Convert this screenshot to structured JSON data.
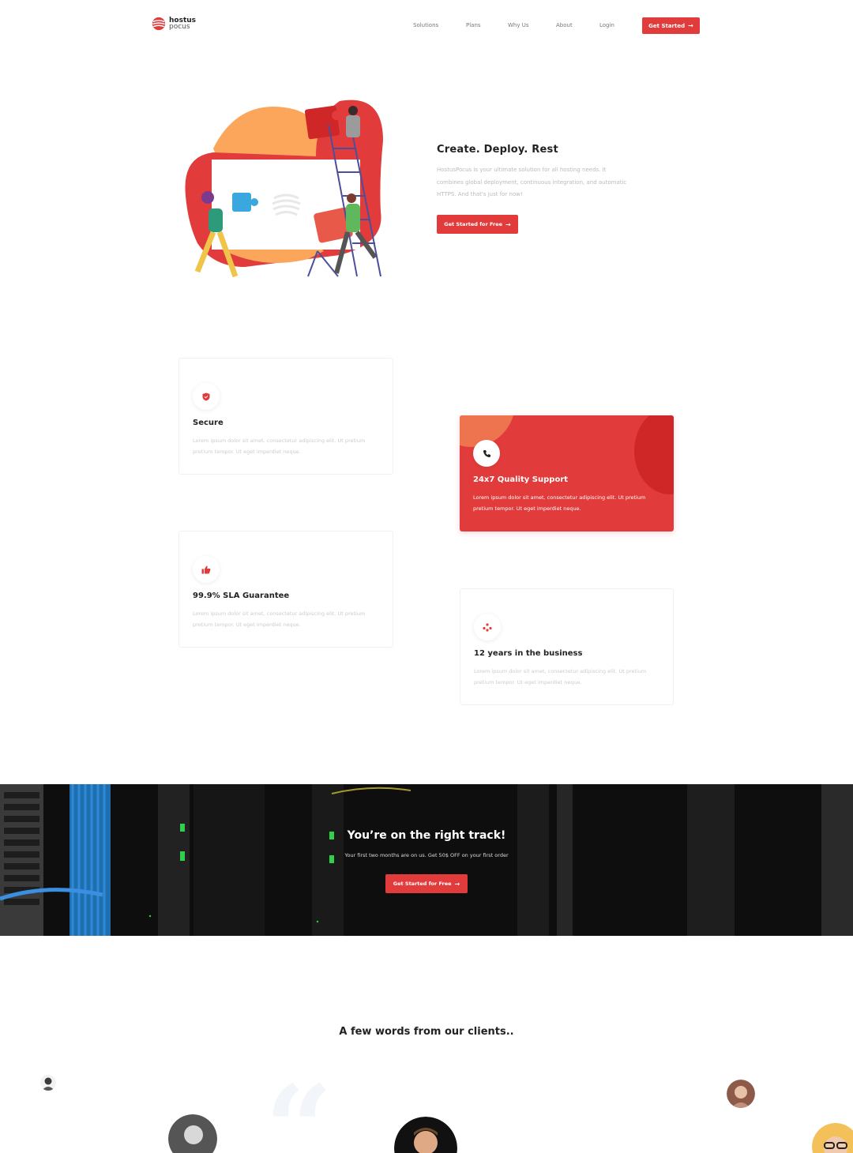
{
  "nav": {
    "logo_line1": "hostus",
    "logo_line2": "pocus",
    "items": [
      "Solutions",
      "Plans",
      "Why Us",
      "About",
      "Login"
    ],
    "cta": "Get Started",
    "cta_icon": "arrow-right-icon"
  },
  "hero": {
    "title": "Create. Deploy. Rest",
    "description": "HostusPocus is your ultimate solution for all hosting needs. It combines global deployment, continuous integration, and automatic HTTPS. And that's just for now!",
    "cta": "Get Started for Free"
  },
  "features": [
    {
      "title": "Secure",
      "description": "Lorem ipsum dolor sit amet, consectetur adipiscing elit. Ut pretium pretium tempor. Ut eget imperdiet neque.",
      "icon": "shield-icon"
    },
    {
      "title": "24x7 Quality Support",
      "description": "Lorem ipsum dolor sit amet, consectetur adipiscing elit. Ut pretium pretium tempor. Ut eget imperdiet neque.",
      "icon": "phone-icon"
    },
    {
      "title": "99.9% SLA Guarantee",
      "description": "Lorem ipsum dolor sit amet, consectetur adipiscing elit. Ut pretium pretium tempor. Ut eget imperdiet neque.",
      "icon": "thumbs-up-icon"
    },
    {
      "title": "12 years in the business",
      "description": "Lorem ipsum dolor sit amet, consectetur adipiscing elit. Ut pretium pretium tempor. Ut eget imperdiet neque.",
      "icon": "network-icon"
    }
  ],
  "banner": {
    "title": "You’re on the right track!",
    "subtitle": "Your first two months are on us. Get 50$ OFF on your first order",
    "cta": "Get Started for Free"
  },
  "testimonials": {
    "title": "A few words from our clients..",
    "quote_icon": "quote-icon"
  },
  "colors": {
    "accent": "#e23b3b",
    "accent_dark": "#cf2727",
    "orange": "#ee7450"
  }
}
